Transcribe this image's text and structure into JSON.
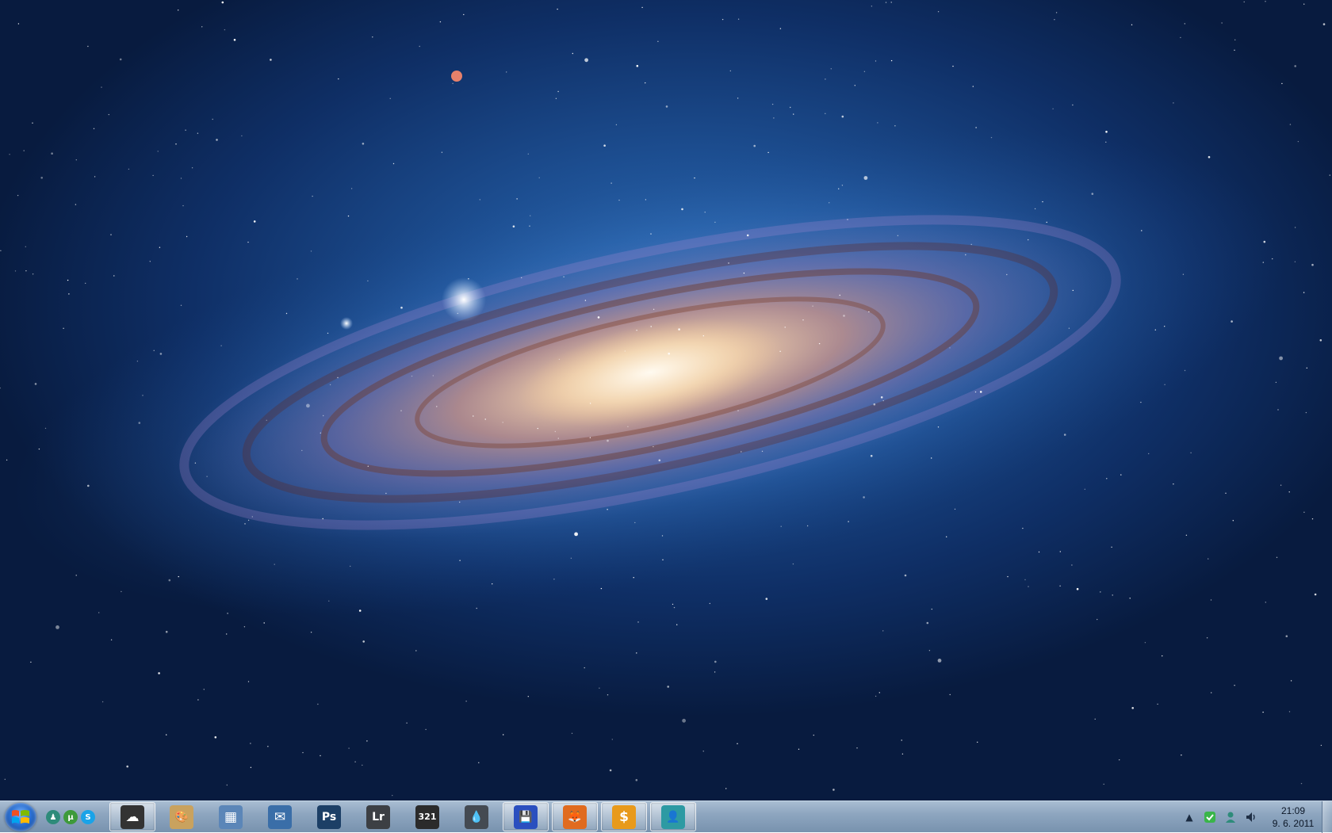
{
  "desktop": {
    "wallpaper": "andromeda-galaxy"
  },
  "taskbar": {
    "start": {
      "icon": "windows-logo-icon"
    },
    "quick_launch": [
      {
        "name": "contact-icon",
        "glyph": "♟",
        "color": "#2e8b7a"
      },
      {
        "name": "utorrent-icon",
        "glyph": "µ",
        "color": "#3e9a3a"
      },
      {
        "name": "skype-icon",
        "glyph": "S",
        "color": "#1aa3e8"
      }
    ],
    "pinned": [
      {
        "name": "sheep-app-icon",
        "glyph": "☁",
        "color": "#333333",
        "active": true
      },
      {
        "name": "paint-icon",
        "glyph": "🎨",
        "color": "#c9a25e",
        "active": false
      },
      {
        "name": "calculator-icon",
        "glyph": "▦",
        "color": "#5b86b8",
        "active": false
      },
      {
        "name": "thunderbird-icon",
        "glyph": "✉",
        "color": "#3a6ea8",
        "active": false
      },
      {
        "name": "photoshop-icon",
        "glyph": "Ps",
        "color": "#1c3f66",
        "active": false
      },
      {
        "name": "lightroom-icon",
        "glyph": "Lr",
        "color": "#3c3f44",
        "active": false
      },
      {
        "name": "media-player-classic-icon",
        "glyph": "321",
        "color": "#2b2b2b",
        "active": false
      },
      {
        "name": "inkscape-drop-icon",
        "glyph": "💧",
        "color": "#444a52",
        "active": false
      },
      {
        "name": "floppy-save-icon",
        "glyph": "💾",
        "color": "#2a4fbf",
        "active": true
      },
      {
        "name": "firefox-icon",
        "glyph": "🦊",
        "color": "#e06b1f",
        "active": true
      },
      {
        "name": "money-app-icon",
        "glyph": "$",
        "color": "#e89a1c",
        "active": true
      },
      {
        "name": "contact-app-icon",
        "glyph": "👤",
        "color": "#2d9aa3",
        "active": true
      }
    ],
    "tray": {
      "time": "21:09",
      "date": "9. 6. 2011"
    }
  },
  "colors": {
    "taskbar_top": "#a9bdd2",
    "taskbar_bottom": "#7892ae",
    "sky_dark": "#081b3f",
    "sky_light": "#2f6fb8"
  }
}
